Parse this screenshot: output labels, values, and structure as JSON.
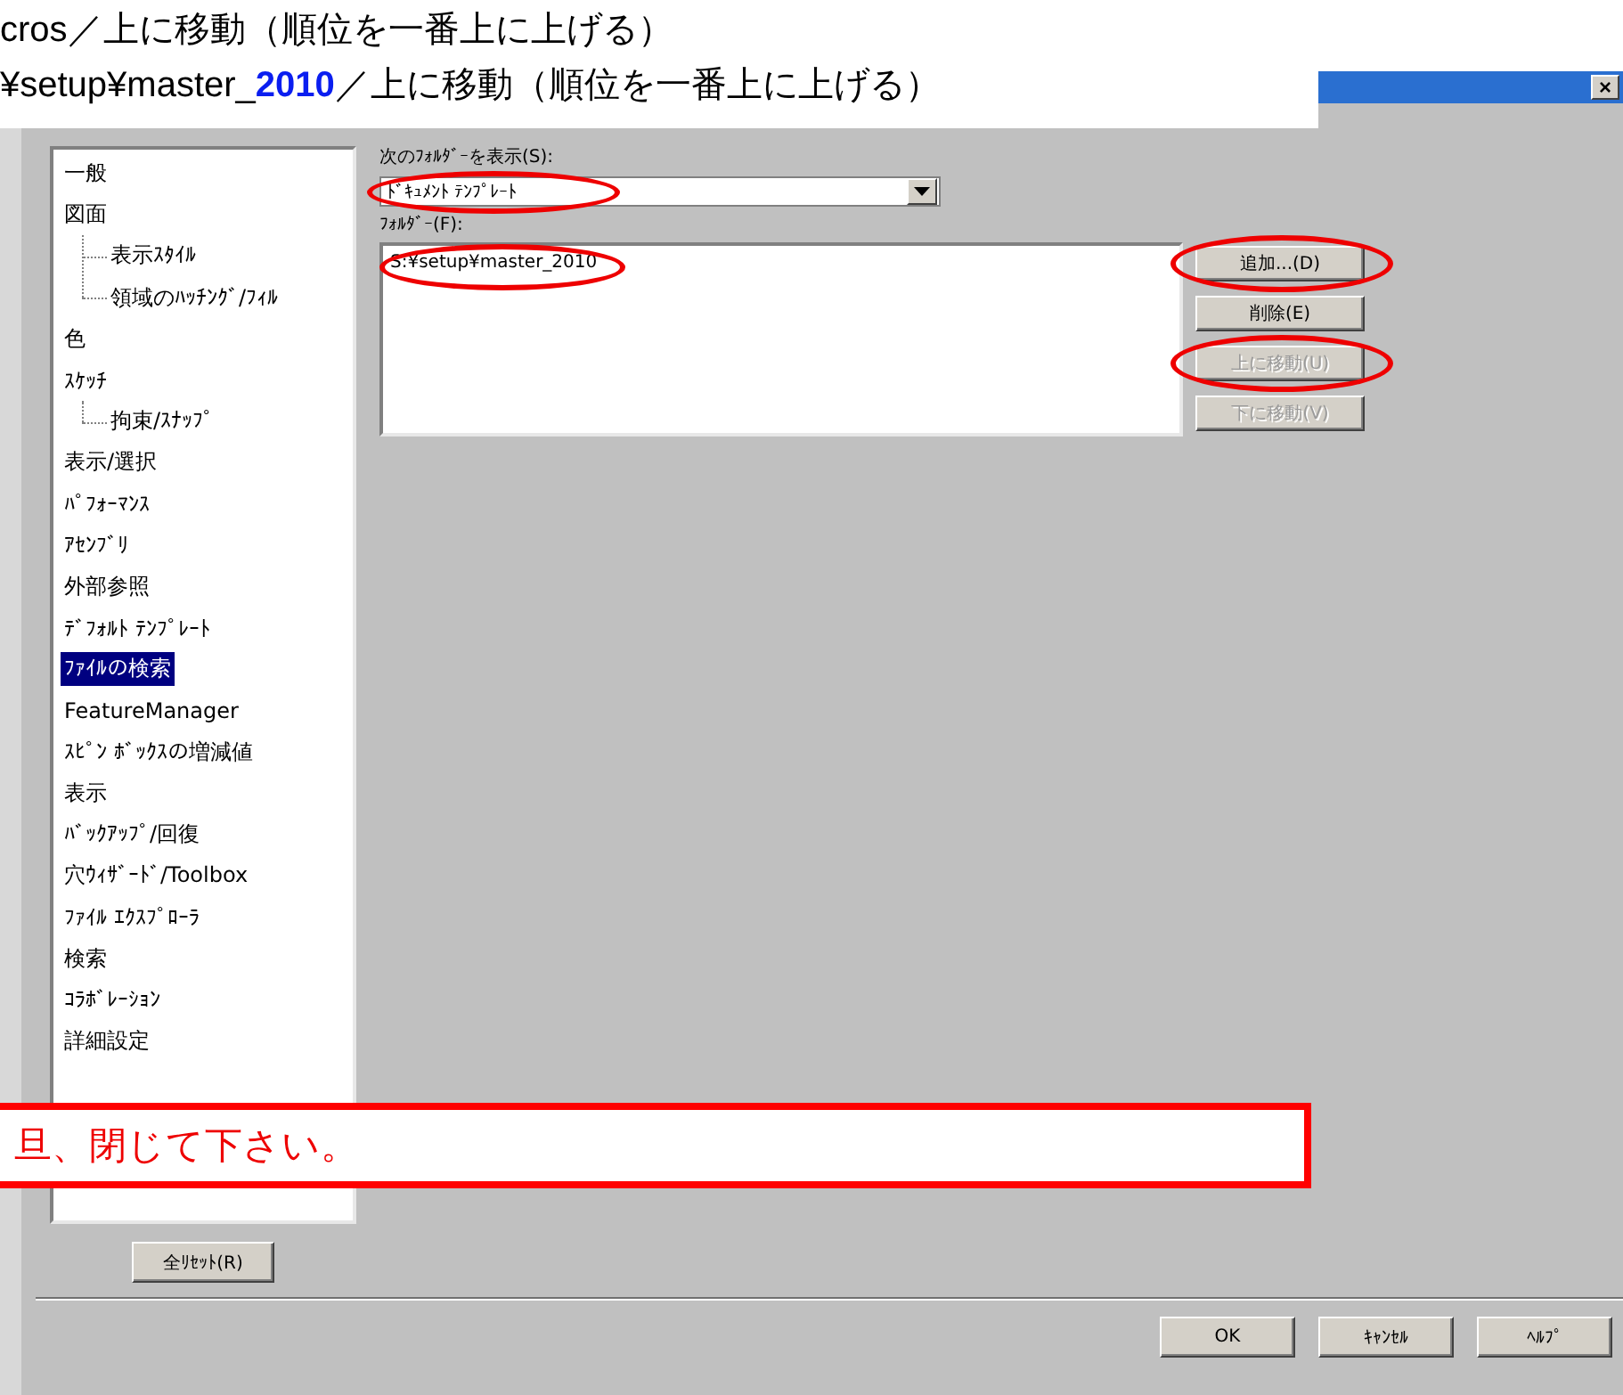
{
  "instructions": [
    "cros／上に移動（順位を一番上に上げる）",
    "¥setup¥master_**2010**／上に移動（順位を一番上に上げる）"
  ],
  "window": {
    "close": "×"
  },
  "sidebar": {
    "items": [
      {
        "label": "一般",
        "selected": false
      },
      {
        "label": "図面",
        "selected": false,
        "children": [
          {
            "label": "表示ｽﾀｲﾙ",
            "selected": false
          },
          {
            "label": "領域のﾊｯﾁﾝｸﾞ/ﾌｨﾙ",
            "selected": false
          }
        ]
      },
      {
        "label": "色",
        "selected": false
      },
      {
        "label": "ｽｹｯﾁ",
        "selected": false,
        "children": [
          {
            "label": "拘束/ｽﾅｯﾌﾟ",
            "selected": false
          }
        ]
      },
      {
        "label": "表示/選択",
        "selected": false
      },
      {
        "label": "ﾊﾟﾌｫｰﾏﾝｽ",
        "selected": false
      },
      {
        "label": "ｱｾﾝﾌﾞﾘ",
        "selected": false
      },
      {
        "label": "外部参照",
        "selected": false
      },
      {
        "label": "ﾃﾞﾌｫﾙﾄ ﾃﾝﾌﾟﾚｰﾄ",
        "selected": false
      },
      {
        "label": "ﾌｧｲﾙの検索",
        "selected": true
      },
      {
        "label": "FeatureManager",
        "selected": false
      },
      {
        "label": "ｽﾋﾟﾝ ﾎﾞｯｸｽの増減値",
        "selected": false
      },
      {
        "label": "表示",
        "selected": false
      },
      {
        "label": "ﾊﾞｯｸｱｯﾌﾟ/回復",
        "selected": false
      },
      {
        "label": "穴ｳｨｻﾞｰﾄﾞ/Toolbox",
        "selected": false
      },
      {
        "label": "ﾌｧｲﾙ ｴｸｽﾌﾟﾛｰﾗ",
        "selected": false
      },
      {
        "label": "検索",
        "selected": false
      },
      {
        "label": "ｺﾗﾎﾞﾚｰｼｮﾝ",
        "selected": false
      },
      {
        "label": "詳細設定",
        "selected": false
      }
    ],
    "reset_button": "全ﾘｾｯﾄ(R)"
  },
  "folder_type": {
    "label": "次のﾌｫﾙﾀﾞｰを表示(S):",
    "value": "ﾄﾞｷｭﾒﾝﾄ ﾃﾝﾌﾟﾚｰﾄ",
    "circled": true
  },
  "folders": {
    "label": "ﾌｫﾙﾀﾞｰ(F):",
    "items": [
      {
        "path": "S:¥setup¥master_2010",
        "circled": true
      }
    ]
  },
  "folder_buttons": [
    {
      "label": "追加...(D)",
      "disabled": false,
      "circled": true
    },
    {
      "label": "削除(E)",
      "disabled": false,
      "circled": false
    },
    {
      "label": "上に移動(U)",
      "disabled": true,
      "circled": true
    },
    {
      "label": "下に移動(V)",
      "disabled": true,
      "circled": false
    }
  ],
  "note": "旦、閉じて下さい。",
  "buttons": [
    "OK",
    "ｷｬﾝｾﾙ",
    "ﾍﾙﾌﾟ"
  ]
}
